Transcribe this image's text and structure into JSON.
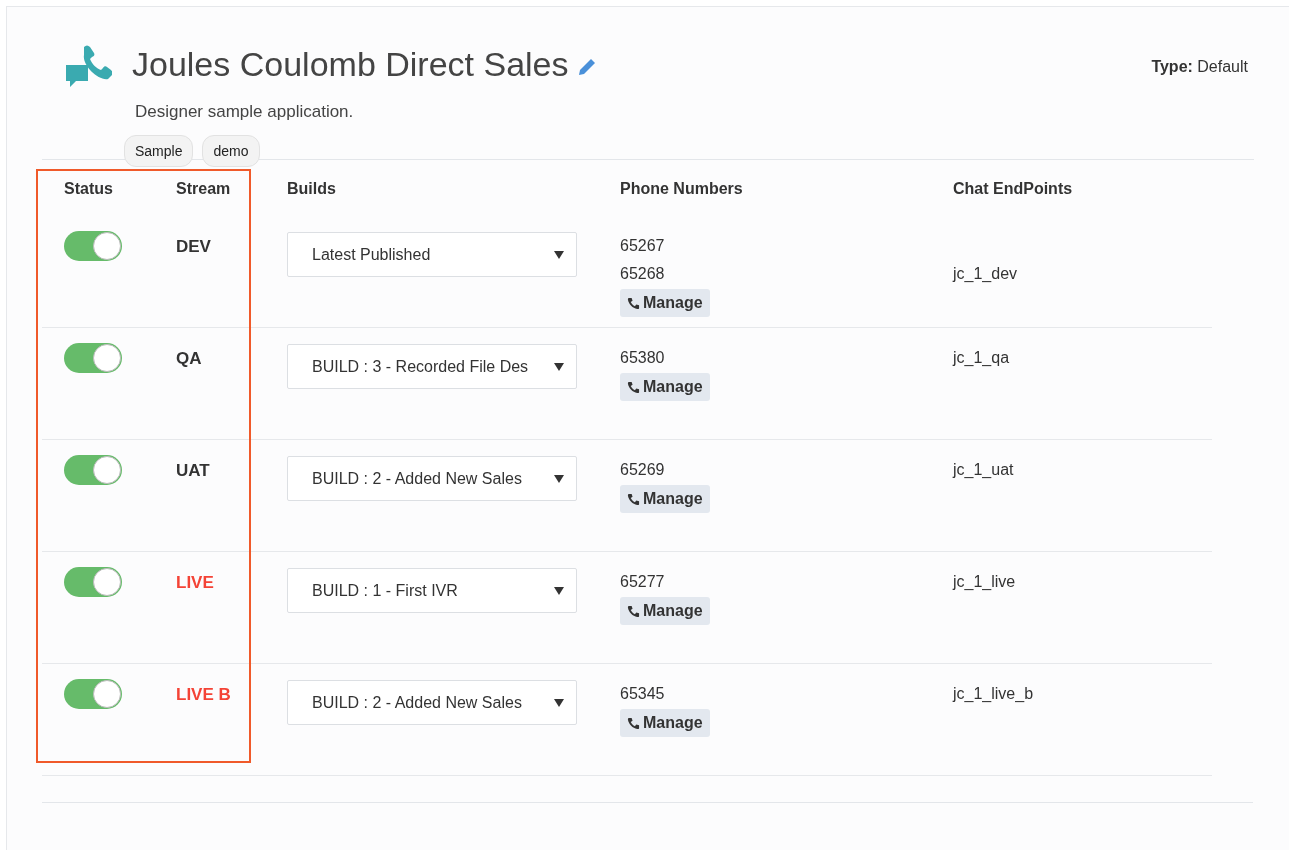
{
  "header": {
    "title": "Joules Coulomb Direct Sales",
    "description": "Designer sample application.",
    "tags": [
      "Sample",
      "demo"
    ],
    "type_label": "Type:",
    "type_value": "Default"
  },
  "table": {
    "columns": [
      "Status",
      "Stream",
      "Builds",
      "Phone Numbers",
      "Chat EndPoints"
    ],
    "rows": [
      {
        "on": true,
        "stream": "DEV",
        "color": "#333333",
        "build": "Latest Published",
        "phones": [
          "65267",
          "65268"
        ],
        "manage": "Manage",
        "chat": "jc_1_dev"
      },
      {
        "on": true,
        "stream": "QA",
        "color": "#333333",
        "build": "BUILD : 3 - Recorded File Des",
        "phones": [
          "65380"
        ],
        "manage": "Manage",
        "chat": "jc_1_qa"
      },
      {
        "on": true,
        "stream": "UAT",
        "color": "#333333",
        "build": "BUILD : 2 - Added New Sales",
        "phones": [
          "65269"
        ],
        "manage": "Manage",
        "chat": "jc_1_uat"
      },
      {
        "on": true,
        "stream": "LIVE",
        "color": "#f44336",
        "build": "BUILD : 1 - First IVR",
        "phones": [
          "65277"
        ],
        "manage": "Manage",
        "chat": "jc_1_live"
      },
      {
        "on": true,
        "stream": "LIVE B",
        "color": "#f44336",
        "build": "BUILD : 2 - Added New Sales",
        "phones": [
          "65345"
        ],
        "manage": "Manage",
        "chat": "jc_1_live_b"
      }
    ]
  }
}
